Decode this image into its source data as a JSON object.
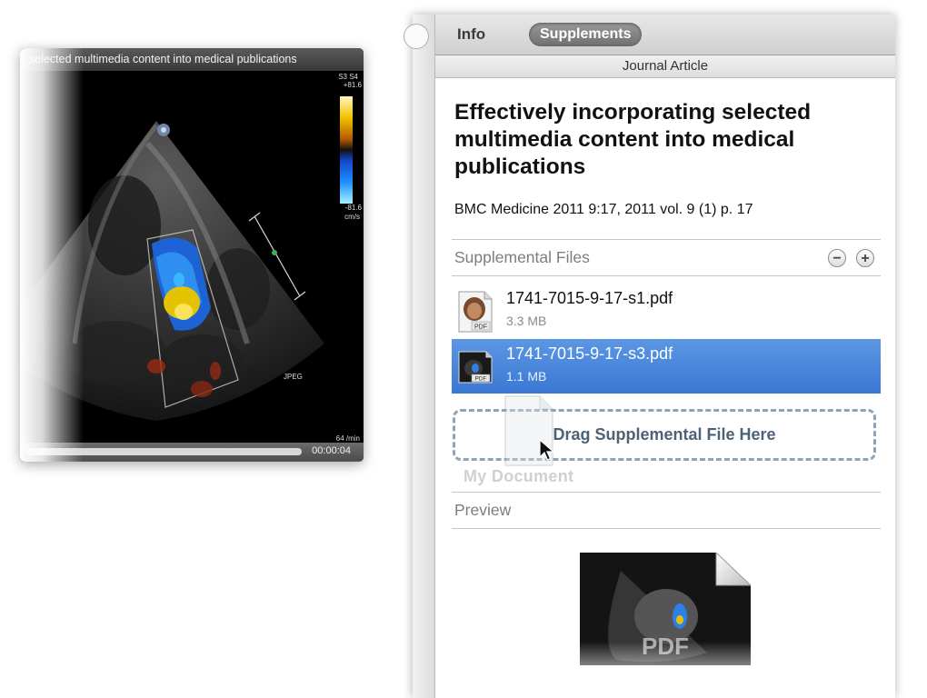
{
  "player": {
    "title": "selected multimedia content into medical publications",
    "scale_top_label": "S3 S4",
    "scale_max": "+81.6",
    "scale_min": "-81.6",
    "scale_unit": "cm/s",
    "format_label": "JPEG",
    "rate_label": "64 /min",
    "timecode": "00:00:04",
    "pause_icon": "pause-icon",
    "fullscreen_icon": "fullscreen-icon"
  },
  "pane": {
    "tabs": [
      {
        "label": "Info",
        "active": false
      },
      {
        "label": "Supplements",
        "active": true
      }
    ],
    "subheader": "Journal Article",
    "article_title": "Effectively incorporating selected multimedia content into medical publications",
    "citation": "BMC Medicine 2011 9:17, 2011 vol. 9 (1) p. 17",
    "supplemental_label": "Supplemental Files",
    "remove_btn": "−",
    "add_btn": "+",
    "files": [
      {
        "name": "1741-7015-9-17-s1.pdf",
        "size": "3.3 MB",
        "selected": false,
        "thumb_label": "PDF"
      },
      {
        "name": "1741-7015-9-17-s3.pdf",
        "size": "1.1 MB",
        "selected": true,
        "thumb_label": "PDF"
      }
    ],
    "drop_zone_label": "Drag Supplemental File Here",
    "drag_caption": "My Document",
    "preview_label": "Preview",
    "preview_badge": "PDF"
  },
  "colors": {
    "selection": "#3a78d4",
    "drop_border": "#8fa3b8",
    "tab_active": "#7a7a7a"
  }
}
